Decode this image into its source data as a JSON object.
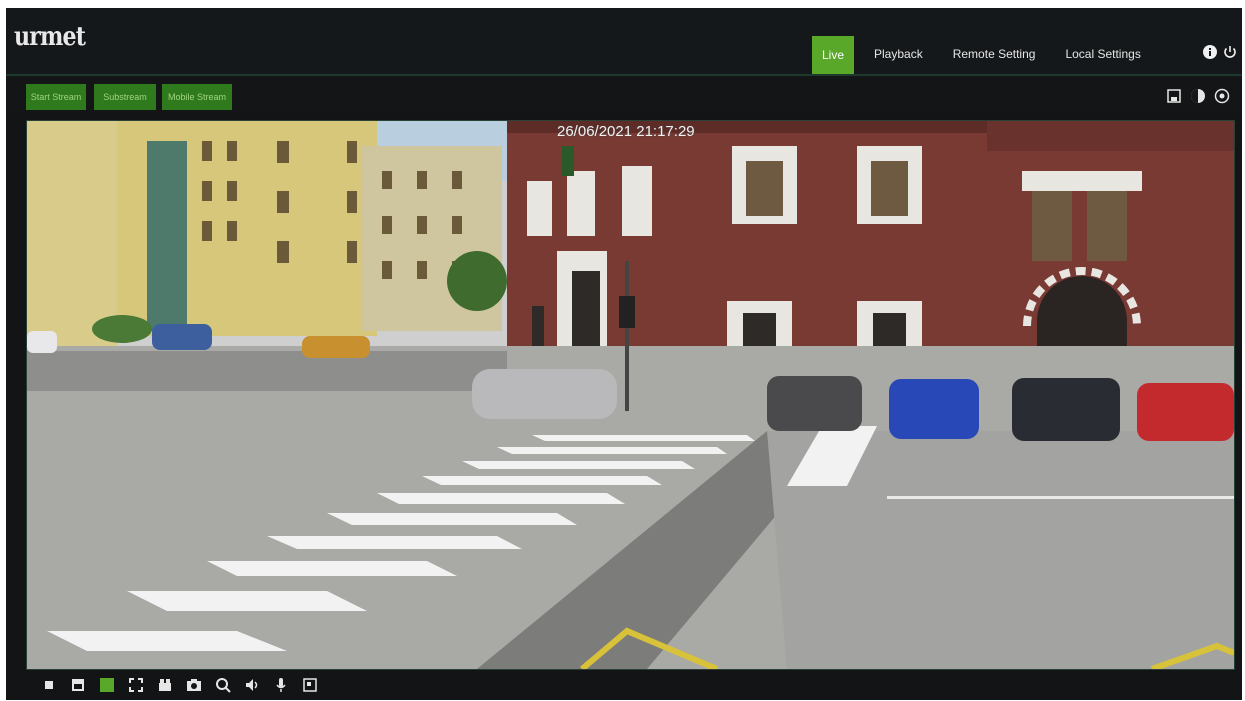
{
  "app": {
    "logo": "urmet"
  },
  "nav": {
    "items": [
      {
        "label": "Live",
        "active": true
      },
      {
        "label": "Playback",
        "active": false
      },
      {
        "label": "Remote Setting",
        "active": false
      },
      {
        "label": "Local Settings",
        "active": false
      }
    ]
  },
  "top_icons": [
    "info-icon",
    "power-icon"
  ],
  "streams": {
    "items": [
      "Start Stream",
      "Substream",
      "Mobile Stream"
    ]
  },
  "toolbar_right_icons": [
    "save-icon",
    "color-adjust-icon",
    "settings-icon"
  ],
  "video": {
    "osd_timestamp": "26/06/2021 21:17:29"
  },
  "bottom_icons": [
    "stop-icon",
    "single-view-icon",
    "fullscreen-icon",
    "expand-icon",
    "record-icon",
    "snapshot-icon",
    "zoom-icon",
    "audio-icon",
    "microphone-icon",
    "window-icon"
  ],
  "colors": {
    "accent": "#5aa82a",
    "background": "#121416",
    "stream_button": "#2f7a1c"
  }
}
